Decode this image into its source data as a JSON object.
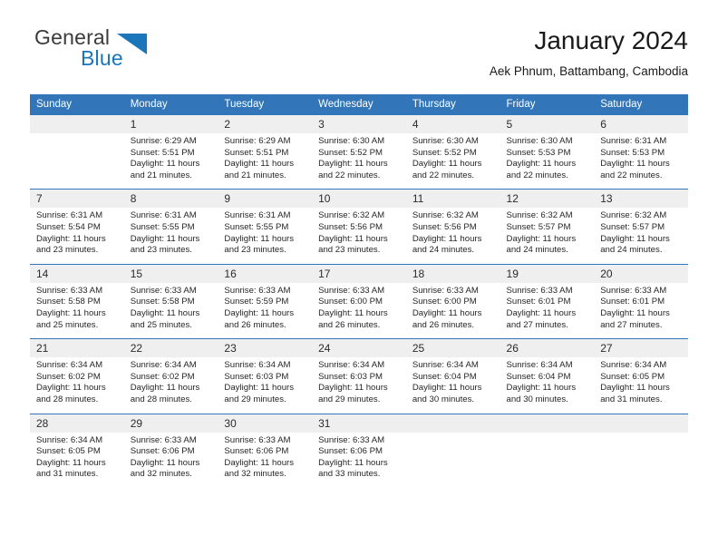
{
  "brand": {
    "name_part1": "General",
    "name_part2": "Blue",
    "triangle_color": "#1b75bb",
    "text_color": "#3b3b3b"
  },
  "header": {
    "title": "January 2024",
    "subtitle": "Aek Phnum, Battambang, Cambodia"
  },
  "theme": {
    "header_blue": "#3275b8",
    "daynum_band": "#efefef",
    "accent_blue": "#1b75bb"
  },
  "calendar": {
    "weekday_headers": [
      "Sunday",
      "Monday",
      "Tuesday",
      "Wednesday",
      "Thursday",
      "Friday",
      "Saturday"
    ],
    "weeks": [
      {
        "days": [
          {
            "number": "",
            "sunrise": "",
            "sunset": "",
            "daylight_line1": "",
            "daylight_line2": ""
          },
          {
            "number": "1",
            "sunrise": "Sunrise: 6:29 AM",
            "sunset": "Sunset: 5:51 PM",
            "daylight_line1": "Daylight: 11 hours",
            "daylight_line2": "and 21 minutes."
          },
          {
            "number": "2",
            "sunrise": "Sunrise: 6:29 AM",
            "sunset": "Sunset: 5:51 PM",
            "daylight_line1": "Daylight: 11 hours",
            "daylight_line2": "and 21 minutes."
          },
          {
            "number": "3",
            "sunrise": "Sunrise: 6:30 AM",
            "sunset": "Sunset: 5:52 PM",
            "daylight_line1": "Daylight: 11 hours",
            "daylight_line2": "and 22 minutes."
          },
          {
            "number": "4",
            "sunrise": "Sunrise: 6:30 AM",
            "sunset": "Sunset: 5:52 PM",
            "daylight_line1": "Daylight: 11 hours",
            "daylight_line2": "and 22 minutes."
          },
          {
            "number": "5",
            "sunrise": "Sunrise: 6:30 AM",
            "sunset": "Sunset: 5:53 PM",
            "daylight_line1": "Daylight: 11 hours",
            "daylight_line2": "and 22 minutes."
          },
          {
            "number": "6",
            "sunrise": "Sunrise: 6:31 AM",
            "sunset": "Sunset: 5:53 PM",
            "daylight_line1": "Daylight: 11 hours",
            "daylight_line2": "and 22 minutes."
          }
        ]
      },
      {
        "days": [
          {
            "number": "7",
            "sunrise": "Sunrise: 6:31 AM",
            "sunset": "Sunset: 5:54 PM",
            "daylight_line1": "Daylight: 11 hours",
            "daylight_line2": "and 23 minutes."
          },
          {
            "number": "8",
            "sunrise": "Sunrise: 6:31 AM",
            "sunset": "Sunset: 5:55 PM",
            "daylight_line1": "Daylight: 11 hours",
            "daylight_line2": "and 23 minutes."
          },
          {
            "number": "9",
            "sunrise": "Sunrise: 6:31 AM",
            "sunset": "Sunset: 5:55 PM",
            "daylight_line1": "Daylight: 11 hours",
            "daylight_line2": "and 23 minutes."
          },
          {
            "number": "10",
            "sunrise": "Sunrise: 6:32 AM",
            "sunset": "Sunset: 5:56 PM",
            "daylight_line1": "Daylight: 11 hours",
            "daylight_line2": "and 23 minutes."
          },
          {
            "number": "11",
            "sunrise": "Sunrise: 6:32 AM",
            "sunset": "Sunset: 5:56 PM",
            "daylight_line1": "Daylight: 11 hours",
            "daylight_line2": "and 24 minutes."
          },
          {
            "number": "12",
            "sunrise": "Sunrise: 6:32 AM",
            "sunset": "Sunset: 5:57 PM",
            "daylight_line1": "Daylight: 11 hours",
            "daylight_line2": "and 24 minutes."
          },
          {
            "number": "13",
            "sunrise": "Sunrise: 6:32 AM",
            "sunset": "Sunset: 5:57 PM",
            "daylight_line1": "Daylight: 11 hours",
            "daylight_line2": "and 24 minutes."
          }
        ]
      },
      {
        "days": [
          {
            "number": "14",
            "sunrise": "Sunrise: 6:33 AM",
            "sunset": "Sunset: 5:58 PM",
            "daylight_line1": "Daylight: 11 hours",
            "daylight_line2": "and 25 minutes."
          },
          {
            "number": "15",
            "sunrise": "Sunrise: 6:33 AM",
            "sunset": "Sunset: 5:58 PM",
            "daylight_line1": "Daylight: 11 hours",
            "daylight_line2": "and 25 minutes."
          },
          {
            "number": "16",
            "sunrise": "Sunrise: 6:33 AM",
            "sunset": "Sunset: 5:59 PM",
            "daylight_line1": "Daylight: 11 hours",
            "daylight_line2": "and 26 minutes."
          },
          {
            "number": "17",
            "sunrise": "Sunrise: 6:33 AM",
            "sunset": "Sunset: 6:00 PM",
            "daylight_line1": "Daylight: 11 hours",
            "daylight_line2": "and 26 minutes."
          },
          {
            "number": "18",
            "sunrise": "Sunrise: 6:33 AM",
            "sunset": "Sunset: 6:00 PM",
            "daylight_line1": "Daylight: 11 hours",
            "daylight_line2": "and 26 minutes."
          },
          {
            "number": "19",
            "sunrise": "Sunrise: 6:33 AM",
            "sunset": "Sunset: 6:01 PM",
            "daylight_line1": "Daylight: 11 hours",
            "daylight_line2": "and 27 minutes."
          },
          {
            "number": "20",
            "sunrise": "Sunrise: 6:33 AM",
            "sunset": "Sunset: 6:01 PM",
            "daylight_line1": "Daylight: 11 hours",
            "daylight_line2": "and 27 minutes."
          }
        ]
      },
      {
        "days": [
          {
            "number": "21",
            "sunrise": "Sunrise: 6:34 AM",
            "sunset": "Sunset: 6:02 PM",
            "daylight_line1": "Daylight: 11 hours",
            "daylight_line2": "and 28 minutes."
          },
          {
            "number": "22",
            "sunrise": "Sunrise: 6:34 AM",
            "sunset": "Sunset: 6:02 PM",
            "daylight_line1": "Daylight: 11 hours",
            "daylight_line2": "and 28 minutes."
          },
          {
            "number": "23",
            "sunrise": "Sunrise: 6:34 AM",
            "sunset": "Sunset: 6:03 PM",
            "daylight_line1": "Daylight: 11 hours",
            "daylight_line2": "and 29 minutes."
          },
          {
            "number": "24",
            "sunrise": "Sunrise: 6:34 AM",
            "sunset": "Sunset: 6:03 PM",
            "daylight_line1": "Daylight: 11 hours",
            "daylight_line2": "and 29 minutes."
          },
          {
            "number": "25",
            "sunrise": "Sunrise: 6:34 AM",
            "sunset": "Sunset: 6:04 PM",
            "daylight_line1": "Daylight: 11 hours",
            "daylight_line2": "and 30 minutes."
          },
          {
            "number": "26",
            "sunrise": "Sunrise: 6:34 AM",
            "sunset": "Sunset: 6:04 PM",
            "daylight_line1": "Daylight: 11 hours",
            "daylight_line2": "and 30 minutes."
          },
          {
            "number": "27",
            "sunrise": "Sunrise: 6:34 AM",
            "sunset": "Sunset: 6:05 PM",
            "daylight_line1": "Daylight: 11 hours",
            "daylight_line2": "and 31 minutes."
          }
        ]
      },
      {
        "days": [
          {
            "number": "28",
            "sunrise": "Sunrise: 6:34 AM",
            "sunset": "Sunset: 6:05 PM",
            "daylight_line1": "Daylight: 11 hours",
            "daylight_line2": "and 31 minutes."
          },
          {
            "number": "29",
            "sunrise": "Sunrise: 6:33 AM",
            "sunset": "Sunset: 6:06 PM",
            "daylight_line1": "Daylight: 11 hours",
            "daylight_line2": "and 32 minutes."
          },
          {
            "number": "30",
            "sunrise": "Sunrise: 6:33 AM",
            "sunset": "Sunset: 6:06 PM",
            "daylight_line1": "Daylight: 11 hours",
            "daylight_line2": "and 32 minutes."
          },
          {
            "number": "31",
            "sunrise": "Sunrise: 6:33 AM",
            "sunset": "Sunset: 6:06 PM",
            "daylight_line1": "Daylight: 11 hours",
            "daylight_line2": "and 33 minutes."
          },
          {
            "number": "",
            "sunrise": "",
            "sunset": "",
            "daylight_line1": "",
            "daylight_line2": ""
          },
          {
            "number": "",
            "sunrise": "",
            "sunset": "",
            "daylight_line1": "",
            "daylight_line2": ""
          },
          {
            "number": "",
            "sunrise": "",
            "sunset": "",
            "daylight_line1": "",
            "daylight_line2": ""
          }
        ]
      }
    ]
  }
}
